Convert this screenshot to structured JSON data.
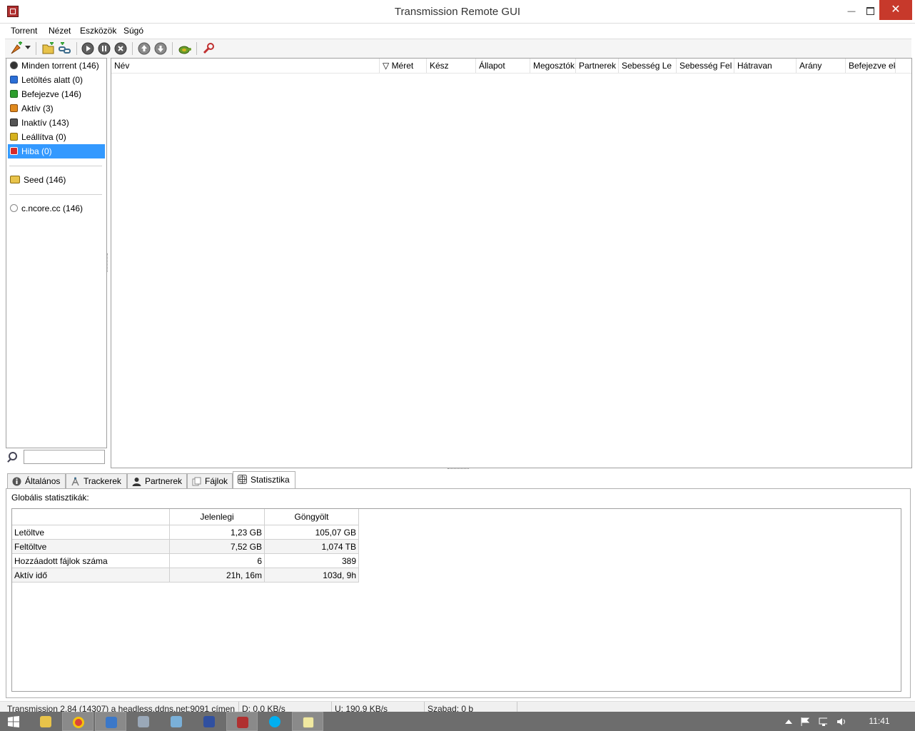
{
  "window": {
    "title": "Transmission Remote GUI",
    "close_glyph": "✕",
    "minimize_glyph": "—"
  },
  "menu": [
    "Torrent",
    "Nézet",
    "Eszközök",
    "Súgó"
  ],
  "toolbar": {
    "icons": [
      "add-torrent-icon",
      "dropdown-arrow-icon",
      "open-folder-icon",
      "add-link-icon",
      "start-icon",
      "pause-icon",
      "stop-icon",
      "move-up-icon",
      "move-down-icon",
      "turtle-mode-icon",
      "options-wrench-icon"
    ]
  },
  "sidebar": {
    "filters": [
      {
        "label": "Minden torrent (146)",
        "icon": "all-torrents-icon",
        "color": "#444444"
      },
      {
        "label": "Letöltés alatt (0)",
        "icon": "downloading-icon",
        "color": "#2b6fd6"
      },
      {
        "label": "Befejezve (146)",
        "icon": "completed-icon",
        "color": "#2e9e2e"
      },
      {
        "label": "Aktív (3)",
        "icon": "active-icon",
        "color": "#e08a1e"
      },
      {
        "label": "Inaktív (143)",
        "icon": "inactive-icon",
        "color": "#555555"
      },
      {
        "label": "Leállítva (0)",
        "icon": "stopped-icon",
        "color": "#d6b21e"
      },
      {
        "label": "Hiba (0)",
        "icon": "error-icon",
        "color": "#d62b2b"
      }
    ],
    "folders": [
      {
        "label": "Seed (146)",
        "icon": "folder-icon"
      }
    ],
    "trackers": [
      {
        "label": "c.ncore.cc (146)",
        "icon": "tracker-icon"
      }
    ],
    "selected_index": 6,
    "search_value": ""
  },
  "list": {
    "columns": [
      "Név",
      "▽ Méret",
      "Kész",
      "Állapot",
      "Megosztók",
      "Partnerek",
      "Sebesség Le",
      "Sebesség Fel",
      "Hátravan",
      "Arány",
      "Befejezve ek"
    ]
  },
  "tabs": [
    "Általános",
    "Trackerek",
    "Partnerek",
    "Fájlok",
    "Statisztika"
  ],
  "active_tab": "Statisztika",
  "stats": {
    "label": "Globális statisztikák:",
    "headers": [
      "",
      "Jelenlegi",
      "Göngyölt"
    ],
    "rows": [
      {
        "name": "Letöltve",
        "current": "1,23 GB",
        "total": "105,07 GB"
      },
      {
        "name": "Feltöltve",
        "current": "7,52 GB",
        "total": "1,074 TB"
      },
      {
        "name": "Hozzáadott fájlok száma",
        "current": "6",
        "total": "389"
      },
      {
        "name": "Aktív idő",
        "current": "21h, 16m",
        "total": "103d, 9h"
      }
    ]
  },
  "status": {
    "connection": "Transmission 2.84 (14307) a headless.ddns.net:9091 címen",
    "download": "D: 0,0 KB/s",
    "upload": "U: 190,9 KB/s",
    "free": "Szabad: 0 b"
  },
  "taskbar": {
    "clock": "11:41"
  }
}
